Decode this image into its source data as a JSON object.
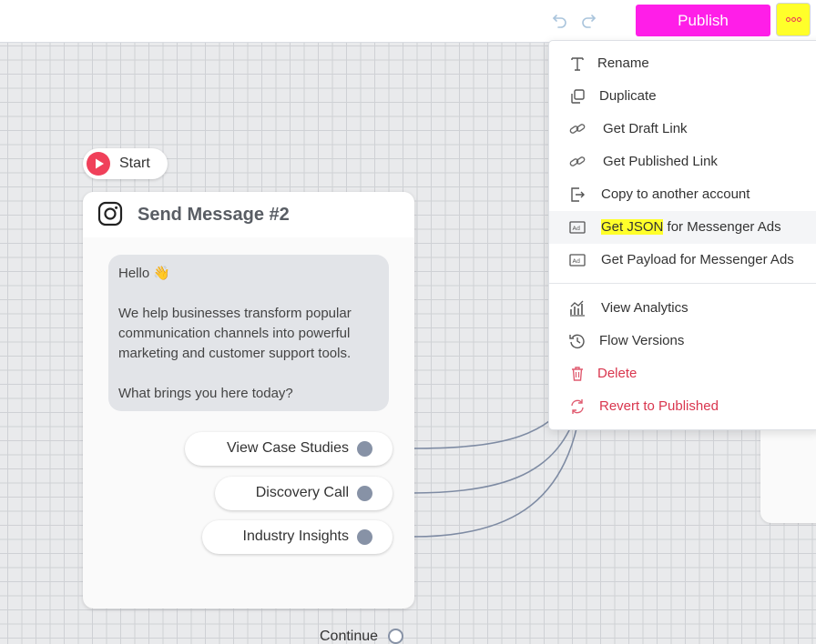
{
  "toolbar": {
    "publish_label": "Publish",
    "undo_icon": "undo-icon",
    "redo_icon": "redo-icon",
    "more_icon": "more-dots-icon"
  },
  "colors": {
    "publish": "#ff1ee8",
    "highlight": "#ffff2a",
    "danger": "#d9364e",
    "port": "#8792a6",
    "start_red": "#f0405a"
  },
  "start": {
    "label": "Start",
    "icon": "play-icon"
  },
  "node": {
    "icon": "instagram-icon",
    "title": "Send Message #2",
    "message": {
      "greeting": "Hello 👋",
      "body": "We help businesses transform popular communication channels into powerful marketing and customer support tools.",
      "question": "What brings you here today?"
    },
    "buttons": [
      {
        "label": "View Case Studies"
      },
      {
        "label": "Discovery Call"
      },
      {
        "label": "Industry Insights"
      }
    ],
    "continue_label": "Continue"
  },
  "menu": {
    "items": [
      {
        "label": "Rename",
        "icon": "text-icon"
      },
      {
        "label": "Duplicate",
        "icon": "copy-icon"
      },
      {
        "label": "Get Draft Link",
        "icon": "link-icon"
      },
      {
        "label": "Get Published Link",
        "icon": "link-icon"
      },
      {
        "label": "Copy to another account",
        "icon": "export-icon"
      },
      {
        "label_highlight": "Get JSON",
        "label_rest": " for Messenger Ads",
        "icon": "ad-icon"
      },
      {
        "label": "Get Payload for Messenger Ads",
        "icon": "ad-icon"
      },
      {
        "label": "View Analytics",
        "icon": "analytics-icon"
      },
      {
        "label": "Flow Versions",
        "icon": "history-icon"
      },
      {
        "label": "Delete",
        "icon": "trash-icon"
      },
      {
        "label": "Revert to Published",
        "icon": "revert-icon"
      }
    ]
  }
}
